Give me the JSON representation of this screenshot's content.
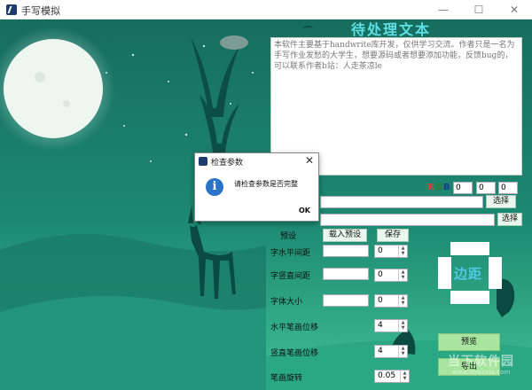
{
  "window": {
    "title": "手写模拟",
    "minimize": "—",
    "maximize": "☐",
    "close": "✕"
  },
  "editor": {
    "heading": "待处理文本",
    "text": "本软件主要基于handwrite库开发，仅供学习交流。作者只是一名为手写作业发愁的大学生，想要源码或者想要添加功能，反馈bug的，可以联系作者b站：人走茶凉le"
  },
  "color": {
    "r_label": "R",
    "g_label": "G",
    "b_label": "B",
    "r_value": "0",
    "g_value": "0",
    "b_value": "0",
    "r_color": "#e53935",
    "g_color": "#2e7d32",
    "b_color": "#1e3a8a"
  },
  "files": {
    "select_label_1": "选择",
    "select_label_2": "选择"
  },
  "preset": {
    "label": "预设",
    "load_label": "载入预设",
    "save_label": "保存"
  },
  "params": {
    "h_spacing_label": "字水平间距",
    "h_spacing_value": "0",
    "v_spacing_label": "字竖直间距",
    "v_spacing_value": "0",
    "font_size_label": "字体大小",
    "font_size_value": "0",
    "h_stroke_label": "水平笔画位移",
    "h_stroke_value": "4",
    "v_stroke_label": "竖直笔画位移",
    "v_stroke_value": "4",
    "rotate_label": "笔画旋转",
    "rotate_value": "0.05"
  },
  "margin": {
    "label": "边距"
  },
  "actions": {
    "preview_label": "预览",
    "export_label": "导出"
  },
  "dialog": {
    "title": "检查参数",
    "close": "✕",
    "info_glyph": "i",
    "message": "请检查参数是否完整",
    "ok": "OK"
  },
  "watermark": {
    "text": "当下软件园",
    "sub": "www.downxia.com"
  }
}
